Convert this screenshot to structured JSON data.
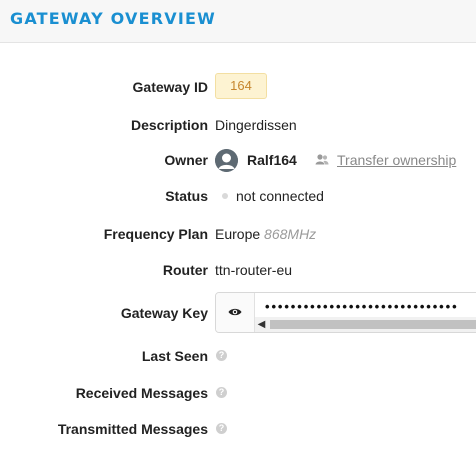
{
  "header": {
    "title": "GATEWAY OVERVIEW"
  },
  "fields": {
    "gateway_id": {
      "label": "Gateway ID",
      "value": "164"
    },
    "description": {
      "label": "Description",
      "value": "Dingerdissen"
    },
    "owner": {
      "label": "Owner",
      "name": "Ralf164",
      "avatar_icon": "user-avatar-icon",
      "transfer_icon": "users-icon",
      "transfer_label": "Transfer ownership"
    },
    "status": {
      "label": "Status",
      "value": "not connected",
      "dot_color": "#d9d9d9"
    },
    "frequency_plan": {
      "label": "Frequency Plan",
      "value": "Europe",
      "unit": "868MHz"
    },
    "router": {
      "label": "Router",
      "value": "ttn-router-eu"
    },
    "gateway_key": {
      "label": "Gateway Key",
      "masked": "••••••••••••••••••••••••••••••",
      "toggle_icon": "eye-icon"
    },
    "last_seen": {
      "label": "Last Seen",
      "help": "?"
    },
    "received_messages": {
      "label": "Received Messages",
      "help": "?"
    },
    "transmitted_messages": {
      "label": "Transmitted Messages",
      "help": "?"
    }
  },
  "colors": {
    "accent": "#1a8fd1",
    "id_badge_bg": "#fdf3d2",
    "id_badge_text": "#c6862e"
  }
}
